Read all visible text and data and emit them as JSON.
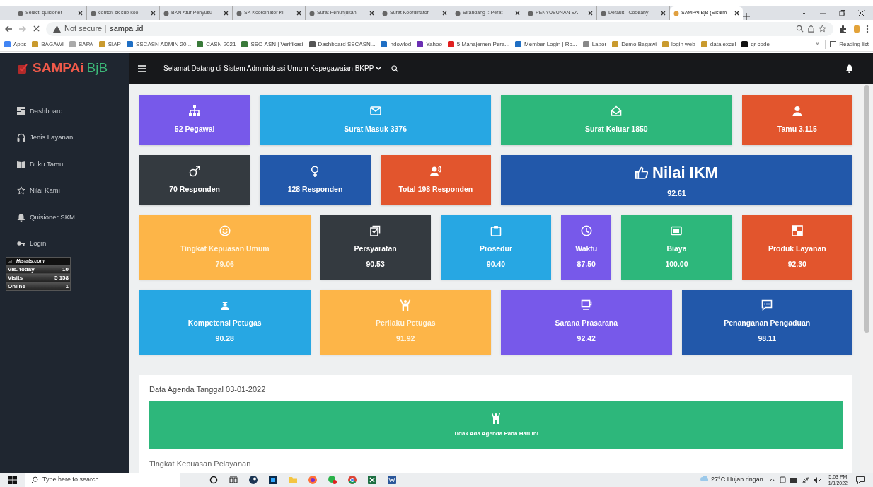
{
  "browser": {
    "tabs": [
      {
        "title": "Select: quisioner -",
        "selected": false
      },
      {
        "title": "contoh sk sub koo",
        "selected": false
      },
      {
        "title": "BKN Atur Penyusu",
        "selected": false
      },
      {
        "title": "SK Koordinator Ki",
        "selected": false
      },
      {
        "title": "Surat Penunjukan",
        "selected": false
      },
      {
        "title": "Surat Koordinator",
        "selected": false
      },
      {
        "title": "Sirandang :: Perat",
        "selected": false
      },
      {
        "title": "PENYUSUNAN SA",
        "selected": false
      },
      {
        "title": "Default - Codeany",
        "selected": false
      },
      {
        "title": "SAMPAi BjB (Sistem",
        "selected": true
      }
    ],
    "security": "Not secure",
    "address": "sampai.id",
    "bookmarks": [
      "Apps",
      "BAGAWI",
      "SAPA",
      "SIAP",
      "SSCASN ADMIN 20...",
      "CASN 2021",
      "SSC-ASN | Verifikasi",
      "Dashboard SSCASN...",
      "ndowlod",
      "Yahoo",
      "5 Manajemen Pera...",
      "Member Login | Ro...",
      "Lapor",
      "Demo  Bagawi",
      "login web",
      "data excel",
      "qr code"
    ],
    "more": "»",
    "reading_list": "Reading list"
  },
  "app": {
    "brand": {
      "name": "SAMPAi",
      "suffix": "BjB"
    },
    "header_title": "Selamat Datang di Sistem Administrasi Umum Kepegawaian BKPP",
    "sidebar": [
      "Dashboard",
      "Jenis Layanan",
      "Buku Tamu",
      "Nilai Kami",
      "Quisioner SKM",
      "Login"
    ],
    "histats": {
      "title": "Histats.com",
      "rows": [
        {
          "label": "Vis. today",
          "value": "10"
        },
        {
          "label": "Visits",
          "value": "5 158"
        },
        {
          "label": "Online",
          "value": "1"
        }
      ]
    },
    "card_rows": [
      [
        {
          "label": "52 Pegawai",
          "color": "#7759ea"
        },
        {
          "label": "Surat Masuk 3376",
          "color": "#27a7e3"
        },
        {
          "label": "Surat Keluar 1850",
          "color": "#2db77b"
        },
        {
          "label": "Tamu 3.115",
          "color": "#e2552d"
        }
      ],
      [
        {
          "label": "70 Responden",
          "color": "#343a40"
        },
        {
          "label": "128 Responden",
          "color": "#2258aa"
        },
        {
          "label": "Total 198 Responden",
          "color": "#e2552d"
        },
        {
          "label": "Nilai IKM",
          "value": "92.61",
          "color": "#2258aa"
        }
      ],
      [
        {
          "label": "Tingkat Kepuasan Umum",
          "value": "79.06",
          "color": "#fdb548"
        },
        {
          "label": "Persyaratan",
          "value": "90.53",
          "color": "#343a40"
        },
        {
          "label": "Prosedur",
          "value": "90.40",
          "color": "#27a7e3"
        },
        {
          "label": "Waktu",
          "value": "87.50",
          "color": "#7759ea"
        },
        {
          "label": "Biaya",
          "value": "100.00",
          "color": "#2db77b"
        },
        {
          "label": "Produk Layanan",
          "value": "92.30",
          "color": "#e2552d"
        }
      ],
      [
        {
          "label": "Kompetensi Petugas",
          "value": "90.28",
          "color": "#27a7e3"
        },
        {
          "label": "Perilaku Petugas",
          "value": "91.92",
          "color": "#fdb548"
        },
        {
          "label": "Sarana Prasarana",
          "value": "92.42",
          "color": "#7759ea"
        },
        {
          "label": "Penanganan Pengaduan",
          "value": "98.11",
          "color": "#2258aa"
        }
      ]
    ],
    "agenda": {
      "title": "Data Agenda Tanggal 03-01-2022",
      "message": "Tidak Ada Agenda Pada Hari ini"
    },
    "next_section": "Tingkat Kepuasan Pelayanan"
  },
  "taskbar": {
    "search_placeholder": "Type here to search",
    "weather": "27°C  Hujan ringan",
    "time": "5:03 PM",
    "date": "1/3/2022"
  }
}
